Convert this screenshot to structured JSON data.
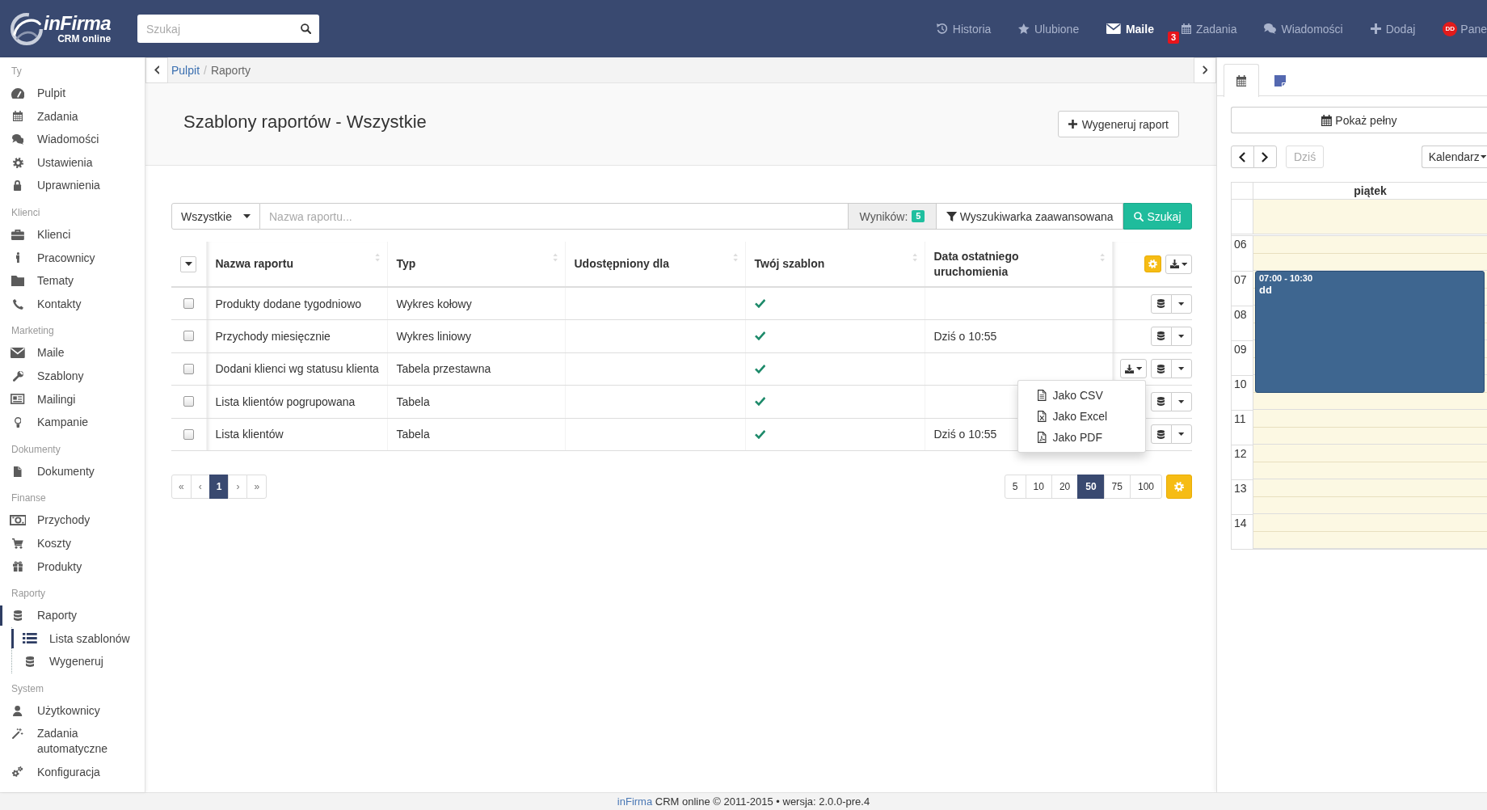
{
  "topbar": {
    "logo": {
      "wordmark": "inFirma",
      "tagline": "CRM online"
    },
    "search": {
      "placeholder": "Szukaj"
    },
    "nav": [
      {
        "label": "Historia",
        "selected": false
      },
      {
        "label": "Ulubione",
        "selected": false
      },
      {
        "label": "Maile",
        "selected": true
      },
      {
        "label": "Zadania",
        "selected": false,
        "badge": "3"
      },
      {
        "label": "Wiadomości",
        "selected": false
      },
      {
        "label": "Dodaj",
        "selected": false
      },
      {
        "label": "Pane",
        "selected": false,
        "avatar": "DD"
      }
    ]
  },
  "sidebar": {
    "sections": [
      {
        "title": "Ty",
        "items": [
          {
            "label": "Pulpit",
            "selected": false
          },
          {
            "label": "Zadania",
            "selected": false
          },
          {
            "label": "Wiadomości",
            "selected": false
          },
          {
            "label": "Ustawienia",
            "selected": false
          },
          {
            "label": "Uprawnienia",
            "selected": false
          }
        ]
      },
      {
        "title": "Klienci",
        "items": [
          {
            "label": "Klienci",
            "selected": false
          },
          {
            "label": "Pracownicy",
            "selected": false
          },
          {
            "label": "Tematy",
            "selected": false
          },
          {
            "label": "Kontakty",
            "selected": false
          }
        ]
      },
      {
        "title": "Marketing",
        "items": [
          {
            "label": "Maile",
            "selected": false
          },
          {
            "label": "Szablony",
            "selected": false
          },
          {
            "label": "Mailingi",
            "selected": false
          },
          {
            "label": "Kampanie",
            "selected": false
          }
        ]
      },
      {
        "title": "Dokumenty",
        "items": [
          {
            "label": "Dokumenty",
            "selected": false
          }
        ]
      },
      {
        "title": "Finanse",
        "items": [
          {
            "label": "Przychody",
            "selected": false
          },
          {
            "label": "Koszty",
            "selected": false
          },
          {
            "label": "Produkty",
            "selected": false
          }
        ]
      },
      {
        "title": "Raporty",
        "items": [
          {
            "label": "Raporty",
            "selected": true,
            "children": [
              {
                "label": "Lista szablonów",
                "selected": true
              },
              {
                "label": "Wygeneruj",
                "selected": false
              }
            ]
          }
        ]
      },
      {
        "title": "System",
        "items": [
          {
            "label": "Użytkownicy",
            "selected": false
          },
          {
            "label": "Zadania automatyczne",
            "selected": false
          },
          {
            "label": "Konfiguracja",
            "selected": false
          }
        ]
      }
    ]
  },
  "breadcrumb": {
    "items": [
      "Pulpit",
      "Raporty"
    ],
    "separator": "/"
  },
  "page": {
    "title": "Szablony raportów - Wszystkie",
    "action": "Wygeneruj raport"
  },
  "filter_bar": {
    "scope": "Wszystkie",
    "search": {
      "placeholder": "Nazwa raportu..."
    },
    "results_label": "Wyników:",
    "results_count": "5",
    "advanced": "Wyszukiwarka zaawansowana",
    "submit": "Szukaj"
  },
  "table": {
    "columns": [
      {
        "label": "Nazwa raportu",
        "sortable": true
      },
      {
        "label": "Typ",
        "sortable": true
      },
      {
        "label": "Udostępniony dla",
        "sortable": true
      },
      {
        "label": "Twój szablon",
        "sortable": true
      },
      {
        "label": "Data ostatniego uruchomienia",
        "sortable": true
      }
    ],
    "rows": [
      {
        "checked": false,
        "name": "Produkty dodane tygodniowo",
        "type": "Wykres kołowy",
        "mine": true
      },
      {
        "checked": false,
        "name": "Przychody miesięcznie",
        "type": "Wykres liniowy",
        "mine": true,
        "last_run": "Dziś o 10:55"
      },
      {
        "checked": false,
        "name": "Dodani klienci wg statusu klienta",
        "type": "Tabela przestawna",
        "mine": true,
        "export_menu": {
          "open": true,
          "items": [
            {
              "label": "Jako CSV"
            },
            {
              "label": "Jako Excel"
            },
            {
              "label": "Jako PDF"
            }
          ]
        }
      },
      {
        "checked": false,
        "name": "Lista klientów pogrupowana",
        "type": "Tabela",
        "mine": true
      },
      {
        "checked": false,
        "name": "Lista klientów",
        "type": "Tabela",
        "mine": true,
        "last_run": "Dziś o 10:55"
      }
    ]
  },
  "pagination": {
    "pages": [
      {
        "label": "«",
        "selected": false
      },
      {
        "label": "‹",
        "selected": false
      },
      {
        "label": "1",
        "selected": true
      },
      {
        "label": "›",
        "selected": false
      },
      {
        "label": "»",
        "selected": false
      }
    ],
    "page_sizes": [
      {
        "label": "5",
        "selected": false
      },
      {
        "label": "10",
        "selected": false
      },
      {
        "label": "20",
        "selected": false
      },
      {
        "label": "50",
        "selected": true
      },
      {
        "label": "75",
        "selected": false
      },
      {
        "label": "100",
        "selected": false
      }
    ]
  },
  "panel": {
    "tabs": [
      {
        "selected": true
      },
      {
        "selected": false
      }
    ],
    "show_full": "Pokaż pełny",
    "today": {
      "label": "Dziś",
      "disabled": true
    },
    "view": "Kalendarz",
    "day": "piątek",
    "hours": [
      "06",
      "07",
      "08",
      "09",
      "10",
      "11",
      "12",
      "13",
      "14"
    ],
    "events": [
      {
        "time": "07:00 - 10:30",
        "title": "dd"
      }
    ]
  },
  "footer": {
    "link": "inFirma",
    "text": "CRM online © 2011-2015 • wersja: 2.0.0-pre.4"
  }
}
